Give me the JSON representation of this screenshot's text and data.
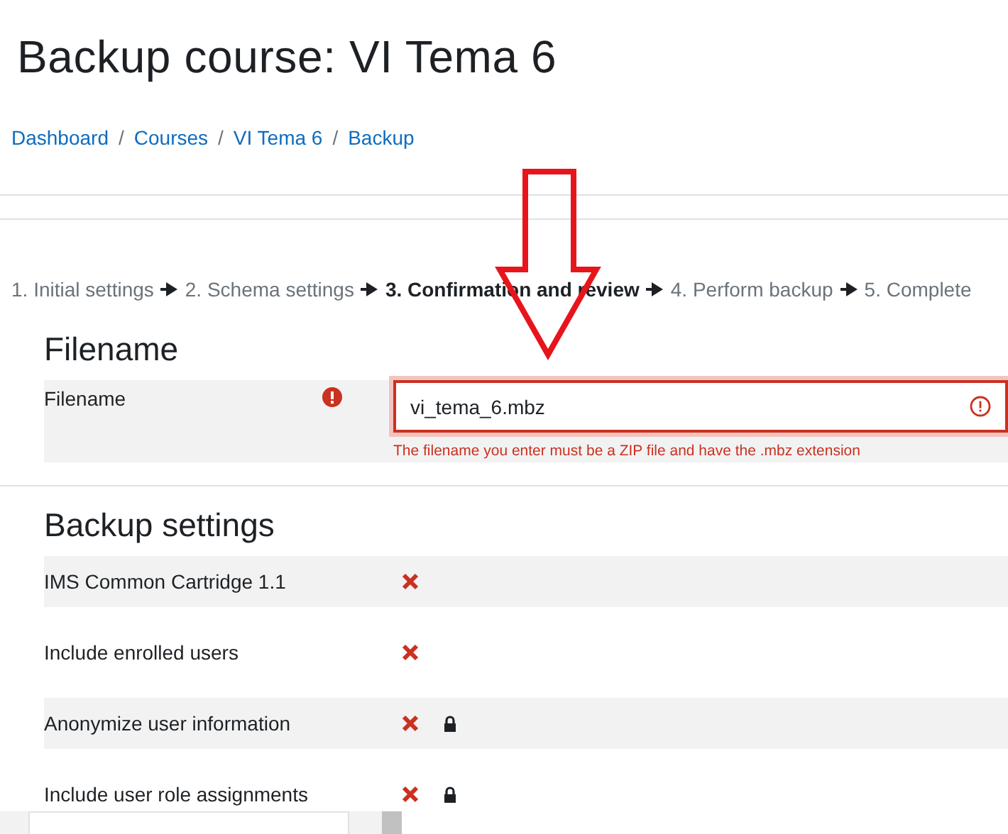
{
  "page_title": "Backup course: VI Tema 6",
  "breadcrumb": [
    {
      "label": "Dashboard"
    },
    {
      "separator": "/",
      "label": "Courses"
    },
    {
      "separator": "/",
      "label": "VI Tema 6"
    },
    {
      "separator": "/",
      "label": "Backup"
    }
  ],
  "steps": [
    {
      "label": "1. Initial settings",
      "selected": false
    },
    {
      "label": "2. Schema settings",
      "selected": false
    },
    {
      "label": "3. Confirmation and review",
      "selected": true
    },
    {
      "label": "4. Perform backup",
      "selected": false
    },
    {
      "label": "5. Complete",
      "selected": false
    }
  ],
  "filename_section": {
    "heading": "Filename",
    "label": "Filename",
    "required": true,
    "value": "vi_tema_6.mbz",
    "invalid": true,
    "error": "The filename you enter must be a ZIP file and have the .mbz extension"
  },
  "settings_section": {
    "heading": "Backup settings",
    "items": [
      {
        "label": "IMS Common Cartridge 1.1",
        "enabled": false,
        "locked": false
      },
      {
        "label": "Include enrolled users",
        "enabled": false,
        "locked": false
      },
      {
        "label": "Anonymize user information",
        "enabled": false,
        "locked": true
      },
      {
        "label": "Include user role assignments",
        "enabled": false,
        "locked": true
      }
    ]
  }
}
